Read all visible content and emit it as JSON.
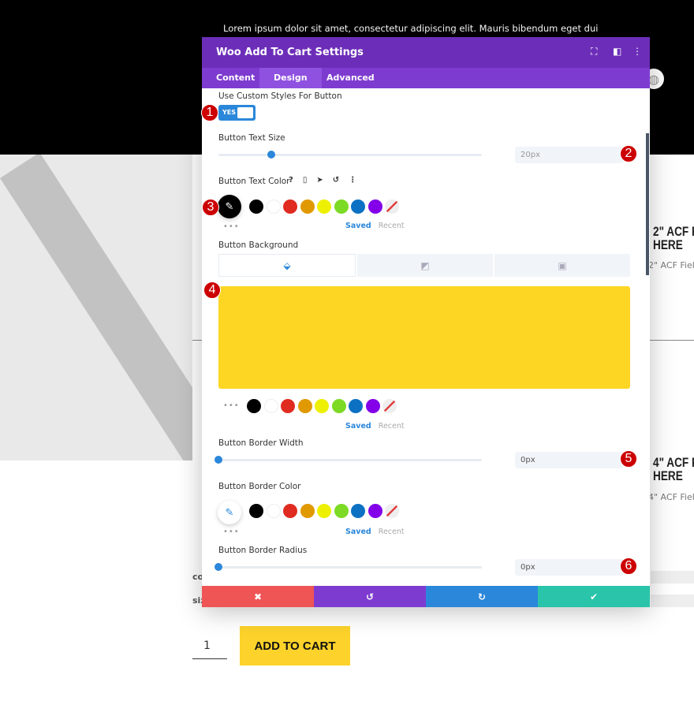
{
  "page": {
    "lorem": "Lorem ipsum dolor sit amet, consectetur adipiscing elit. Mauris bibendum eget dui",
    "product1_title": "2\" ACF F\nHERE",
    "product1_sub": "2\" ACF Fiel",
    "product2_title": "4\" ACF F\nHERE",
    "product2_sub": "4\" ACF Fiel",
    "label_color": "co",
    "label_size": "siz",
    "quantity": "1",
    "add_to_cart": "ADD TO CART"
  },
  "modal": {
    "title": "Woo Add To Cart Settings",
    "tabs": [
      {
        "label": "Content"
      },
      {
        "label": "Design",
        "active": true
      },
      {
        "label": "Advanced"
      }
    ],
    "use_custom_styles": {
      "label": "Use Custom Styles For Button",
      "value": "YES"
    },
    "text_size": {
      "label": "Button Text Size",
      "value": "20px",
      "level": 0.2
    },
    "text_color": {
      "label": "Button Text Color",
      "current": "#000000"
    },
    "background": {
      "label": "Button Background",
      "color": "#fdd624"
    },
    "border_width": {
      "label": "Button Border Width",
      "value": "0px",
      "level": 0
    },
    "border_color": {
      "label": "Button Border Color"
    },
    "border_radius": {
      "label": "Button Border Radius",
      "value": "0px",
      "level": 0
    },
    "saved": "Saved",
    "recent": "Recent",
    "swatches": [
      "#000000",
      "#ffffff",
      "#e02b20",
      "#e09900",
      "#edf000",
      "#7cda24",
      "#0c71c3",
      "#8300e9",
      "none"
    ],
    "footer_colors": {
      "cancel": "#ef5555",
      "undo": "#7e3bd0",
      "redo": "#2b87da",
      "save": "#29c4a9"
    }
  },
  "badges": [
    "1",
    "2",
    "3",
    "4",
    "5",
    "6"
  ]
}
